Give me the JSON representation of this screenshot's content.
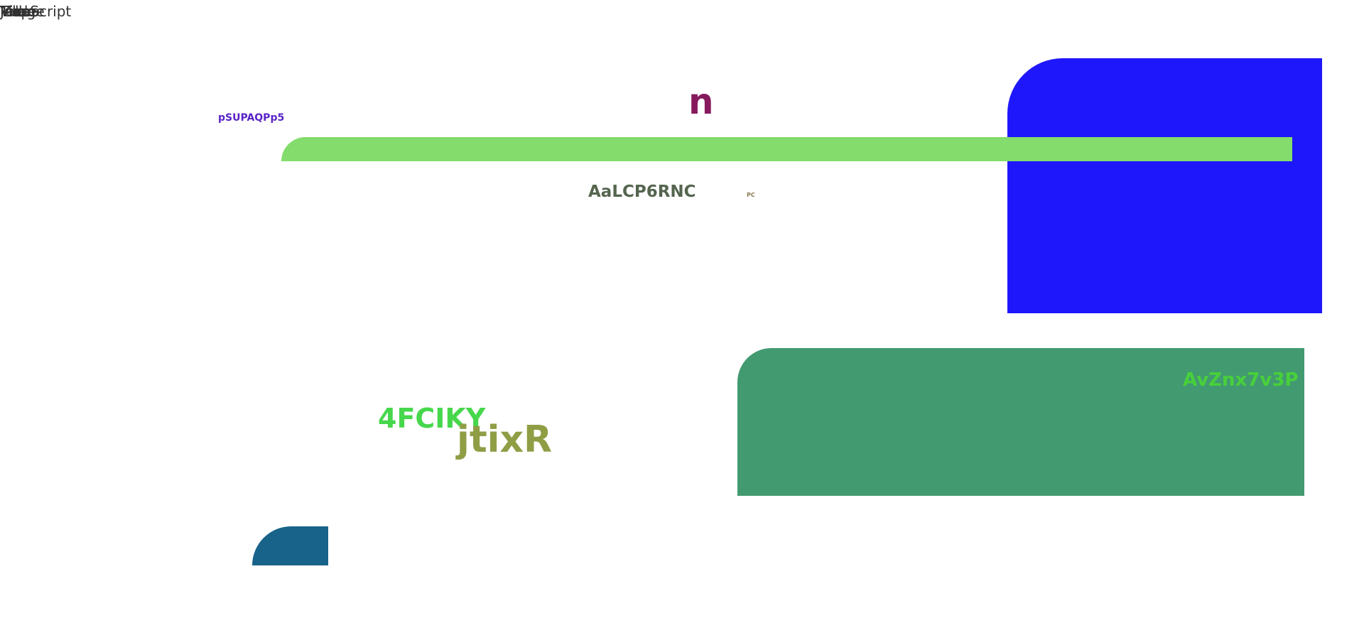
{
  "corner_labels": [
    "JavaScript",
    "Image",
    "Video",
    "Map",
    "Table",
    "Tile"
  ],
  "labels": {
    "small_purple": "pSUPAQPp5",
    "big_letter": "n",
    "center_code": "AaLCP6RNC",
    "tiny_code": "PC",
    "green_code": "4FCIKY",
    "olive_code": "jtixR",
    "panel_code": "AvZnx7v3P"
  },
  "colors": {
    "blue_panel": "#1f17fb",
    "green_bar": "#83dc6c",
    "teal_panel": "#429a71",
    "navy_block": "#17638a"
  }
}
